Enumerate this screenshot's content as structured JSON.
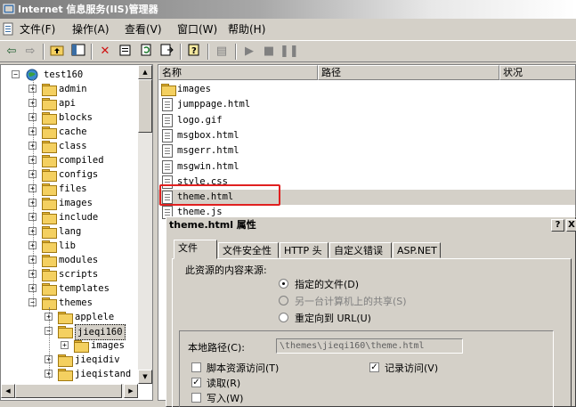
{
  "window": {
    "title": "Internet 信息服务(IIS)管理器"
  },
  "menu": [
    {
      "label": "文件(F)"
    },
    {
      "label": "操作(A)"
    },
    {
      "label": "查看(V)"
    },
    {
      "label": "窗口(W)"
    },
    {
      "label": "帮助(H)"
    }
  ],
  "tree": {
    "root": "test160",
    "items": [
      "admin",
      "api",
      "blocks",
      "cache",
      "class",
      "compiled",
      "configs",
      "files",
      "images",
      "include",
      "lang",
      "lib",
      "modules",
      "scripts",
      "templates",
      "themes"
    ],
    "themes_children": [
      "applele",
      "jieqi160",
      "jieqidiv"
    ],
    "jieqi160_children": [
      "images"
    ],
    "cut_off": "jieqistand"
  },
  "list": {
    "columns": [
      "名称",
      "路径",
      "状况"
    ],
    "files": [
      {
        "name": "images",
        "type": "folder"
      },
      {
        "name": "jumppage.html",
        "type": "file"
      },
      {
        "name": "logo.gif",
        "type": "file"
      },
      {
        "name": "msgbox.html",
        "type": "file"
      },
      {
        "name": "msgerr.html",
        "type": "file"
      },
      {
        "name": "msgwin.html",
        "type": "file"
      },
      {
        "name": "style.css",
        "type": "file"
      },
      {
        "name": "theme.html",
        "type": "file",
        "selected": true
      },
      {
        "name": "theme.js",
        "type": "file"
      }
    ]
  },
  "dialog": {
    "title": "theme.html 属性",
    "help_btn": "?",
    "close_btn": "X",
    "tabs": [
      "文件",
      "文件安全性",
      "HTTP 头",
      "自定义错误",
      "ASP.NET"
    ],
    "content_source_label": "此资源的内容来源:",
    "radio_options": [
      {
        "label": "指定的文件(D)",
        "checked": true,
        "disabled": false
      },
      {
        "label": "另一台计算机上的共享(S)",
        "checked": false,
        "disabled": true
      },
      {
        "label": "重定向到 URL(U)",
        "checked": false,
        "disabled": false
      }
    ],
    "local_path_label": "本地路径(C):",
    "local_path_value": "\\themes\\jieqi160\\theme.html",
    "checkboxes": [
      {
        "label": "脚本资源访问(T)",
        "checked": false
      },
      {
        "label": "记录访问(V)",
        "checked": true
      },
      {
        "label": "读取(R)",
        "checked": true
      },
      {
        "label": "写入(W)",
        "checked": false
      }
    ]
  },
  "colors": {
    "highlight": "#e02020",
    "selection": "#d4d0c8",
    "folder": "#f4d060"
  }
}
